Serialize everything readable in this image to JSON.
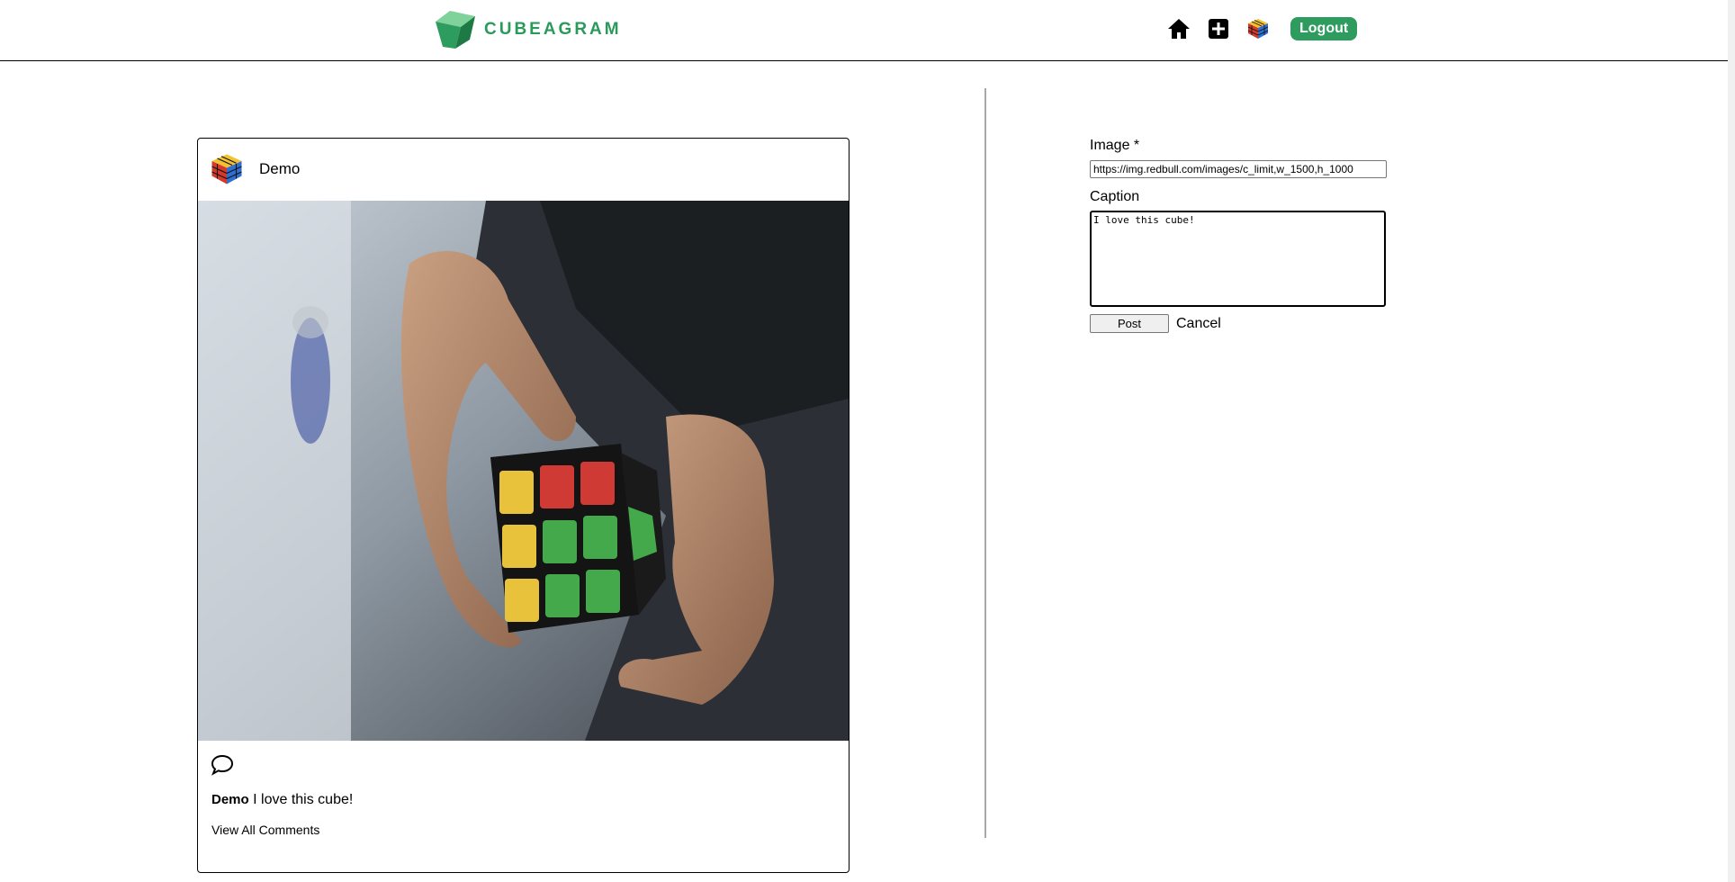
{
  "header": {
    "logo_text": "CUBEAGRAM",
    "nav": {
      "home_icon": "home-icon",
      "new_post_icon": "plus-square-icon",
      "profile_icon": "rubiks-cube-avatar",
      "logout_label": "Logout"
    }
  },
  "post": {
    "username": "Demo",
    "avatar": "rubiks-cube-avatar",
    "image_alt": "hands-solving-rubiks-cube",
    "comment_icon": "speech-bubble-icon",
    "caption_user": "Demo",
    "caption_text": "I love this cube!",
    "view_comments_label": "View All Comments"
  },
  "form": {
    "image_label": "Image *",
    "image_value": "https://img.redbull.com/images/c_limit,w_1500,h_1000",
    "caption_label": "Caption",
    "caption_value": "I love this cube!",
    "post_label": "Post",
    "cancel_label": "Cancel"
  },
  "colors": {
    "brand_green": "#2a9a5b",
    "logout_bg": "#2e9b5f",
    "divider": "#a8a8a8"
  }
}
